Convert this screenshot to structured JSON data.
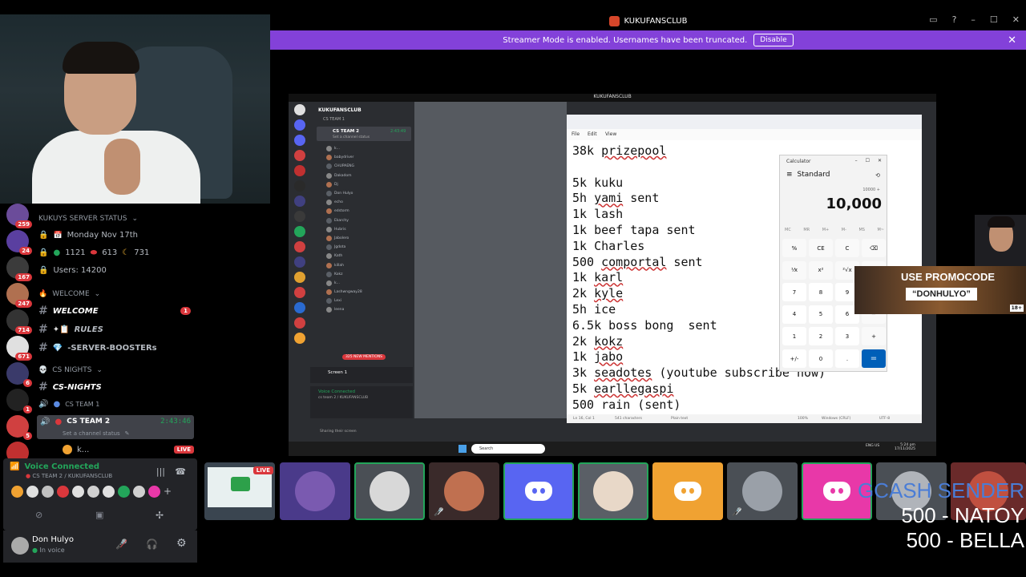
{
  "window": {
    "title": "KUKUFANSCLUB",
    "banner_text": "Streamer Mode is enabled. Usernames have been truncated.",
    "banner_button": "Disable"
  },
  "servers": [
    {
      "badge": "259",
      "color": "#6b4c9a"
    },
    {
      "badge": "24",
      "color": "#5a3fa0"
    },
    {
      "badge": "167",
      "color": "#3b3b3b"
    },
    {
      "badge": "247",
      "color": "#b07050"
    },
    {
      "badge": "714",
      "color": "#333"
    },
    {
      "badge": "671",
      "color": "#e0e0e0"
    },
    {
      "badge": "6",
      "color": "#3a3a6a"
    },
    {
      "badge": "1",
      "color": "#222"
    },
    {
      "badge": "5",
      "color": "#d04040"
    },
    {
      "badge": "NEW",
      "color": "#c03030"
    }
  ],
  "channels": {
    "status_category": "KUKUYS SERVER STATUS",
    "date": "Monday Nov 17th",
    "counts": {
      "green": "1121",
      "red": "613",
      "moon": "731"
    },
    "users": "Users: 14200",
    "welcome_category": "WELCOME",
    "welcome": "WELCOME",
    "welcome_badge": "1",
    "rules": "RULES",
    "boosters": "-SERVER-BOOSTERs",
    "cs_category": "CS NIGHTS",
    "cs_nights": "CS-NIGHTS",
    "cs_team1": "CS TEAM 1",
    "cs_team2": "CS TEAM 2",
    "timer": "2:43:46",
    "channel_status": "Set a channel status",
    "member": "k...",
    "live": "LIVE"
  },
  "voice": {
    "status": "Voice Connected",
    "channel": "CS TEAM 2 / KUKUFANSCLUB"
  },
  "user": {
    "name": "Don Hulyo",
    "status": "In voice"
  },
  "share": {
    "title": "KUKUFANSCLUB",
    "mini_server": "KUKUFANSCLUB",
    "mini_team1": "CS TEAM 1",
    "mini_team2": "CS TEAM 2",
    "mini_timer": "2:43:49",
    "mini_status": "Set a channel status",
    "mini_members": [
      "k...",
      "babydriver",
      "CHUPAENG",
      "Dakadom",
      "Dj",
      "Don Hulyo",
      "echo",
      "edstorm",
      "Ekarchy",
      "Hubris",
      "Jabolero",
      "Jgdota",
      "Kath",
      "killah",
      "Kokz",
      "k...",
      "Lashwngway28",
      "Lexi",
      "leena"
    ],
    "new_mentions": "325 NEW MENTIONS",
    "screen": "Screen 1",
    "voice": "Voice Connected",
    "voice_channel": "cs team 2 / KUKUFANSCLUB",
    "sharing": "Sharing their screen"
  },
  "notepad": {
    "menu": [
      "File",
      "Edit",
      "View"
    ],
    "lines": [
      {
        "pre": "38k ",
        "u": "prizepool",
        "post": ""
      },
      {
        "pre": "",
        "u": "",
        "post": ""
      },
      {
        "pre": "5k kuku",
        "u": "",
        "post": ""
      },
      {
        "pre": "5h ",
        "u": "yami",
        "post": " sent"
      },
      {
        "pre": "1k lash",
        "u": "",
        "post": ""
      },
      {
        "pre": "1k beef tapa sent",
        "u": "",
        "post": ""
      },
      {
        "pre": "1k Charles",
        "u": "",
        "post": ""
      },
      {
        "pre": "500 ",
        "u": "comportal",
        "post": " sent"
      },
      {
        "pre": "1k ",
        "u": "karl",
        "post": ""
      },
      {
        "pre": "2k ",
        "u": "kyle",
        "post": ""
      },
      {
        "pre": "5h ice",
        "u": "",
        "post": ""
      },
      {
        "pre": "6.5k boss bong  sent",
        "u": "",
        "post": ""
      },
      {
        "pre": "2k ",
        "u": "kokz",
        "post": ""
      },
      {
        "pre": "1k ",
        "u": "jabo",
        "post": ""
      },
      {
        "pre": "3k ",
        "u": "seadotes",
        "post": " (youtube subscribe now)"
      },
      {
        "pre": "5k ",
        "u": "earllegaspi",
        "post": ""
      },
      {
        "pre": "500 rain (sent)",
        "u": "",
        "post": ""
      }
    ],
    "status_left": "Ln 16, Col 1",
    "status_chars": "541 characters",
    "status_mode": "Plain text",
    "status_zoom": "100%",
    "status_eol": "Windows (CRLF)",
    "status_enc": "UTF-8"
  },
  "calculator": {
    "title": "Calculator",
    "mode": "Standard",
    "expression": "10000 +",
    "display": "10,000",
    "memory": [
      "MC",
      "MR",
      "M+",
      "M-",
      "MS",
      "M~"
    ],
    "keys": [
      [
        "%",
        "CE",
        "C",
        "⌫"
      ],
      [
        "⅟x",
        "x²",
        "²√x",
        "÷"
      ],
      [
        "7",
        "8",
        "9",
        "×"
      ],
      [
        "4",
        "5",
        "6",
        "−"
      ],
      [
        "1",
        "2",
        "3",
        "+"
      ],
      [
        "+/-",
        "0",
        ".",
        "="
      ]
    ]
  },
  "taskbar": {
    "search": "Search",
    "clock": "5:24 pm",
    "date": "17/11/2025",
    "lang": "ENG US"
  },
  "promo": {
    "line1": "USE PROMOCODE",
    "line2": "“DONHULYO”",
    "age": "18+"
  },
  "tiles_live": "LIVE",
  "overlay": {
    "heading": "GCASH SENDER",
    "lines": [
      "500 - NATOY",
      "500  - BELLA"
    ]
  }
}
